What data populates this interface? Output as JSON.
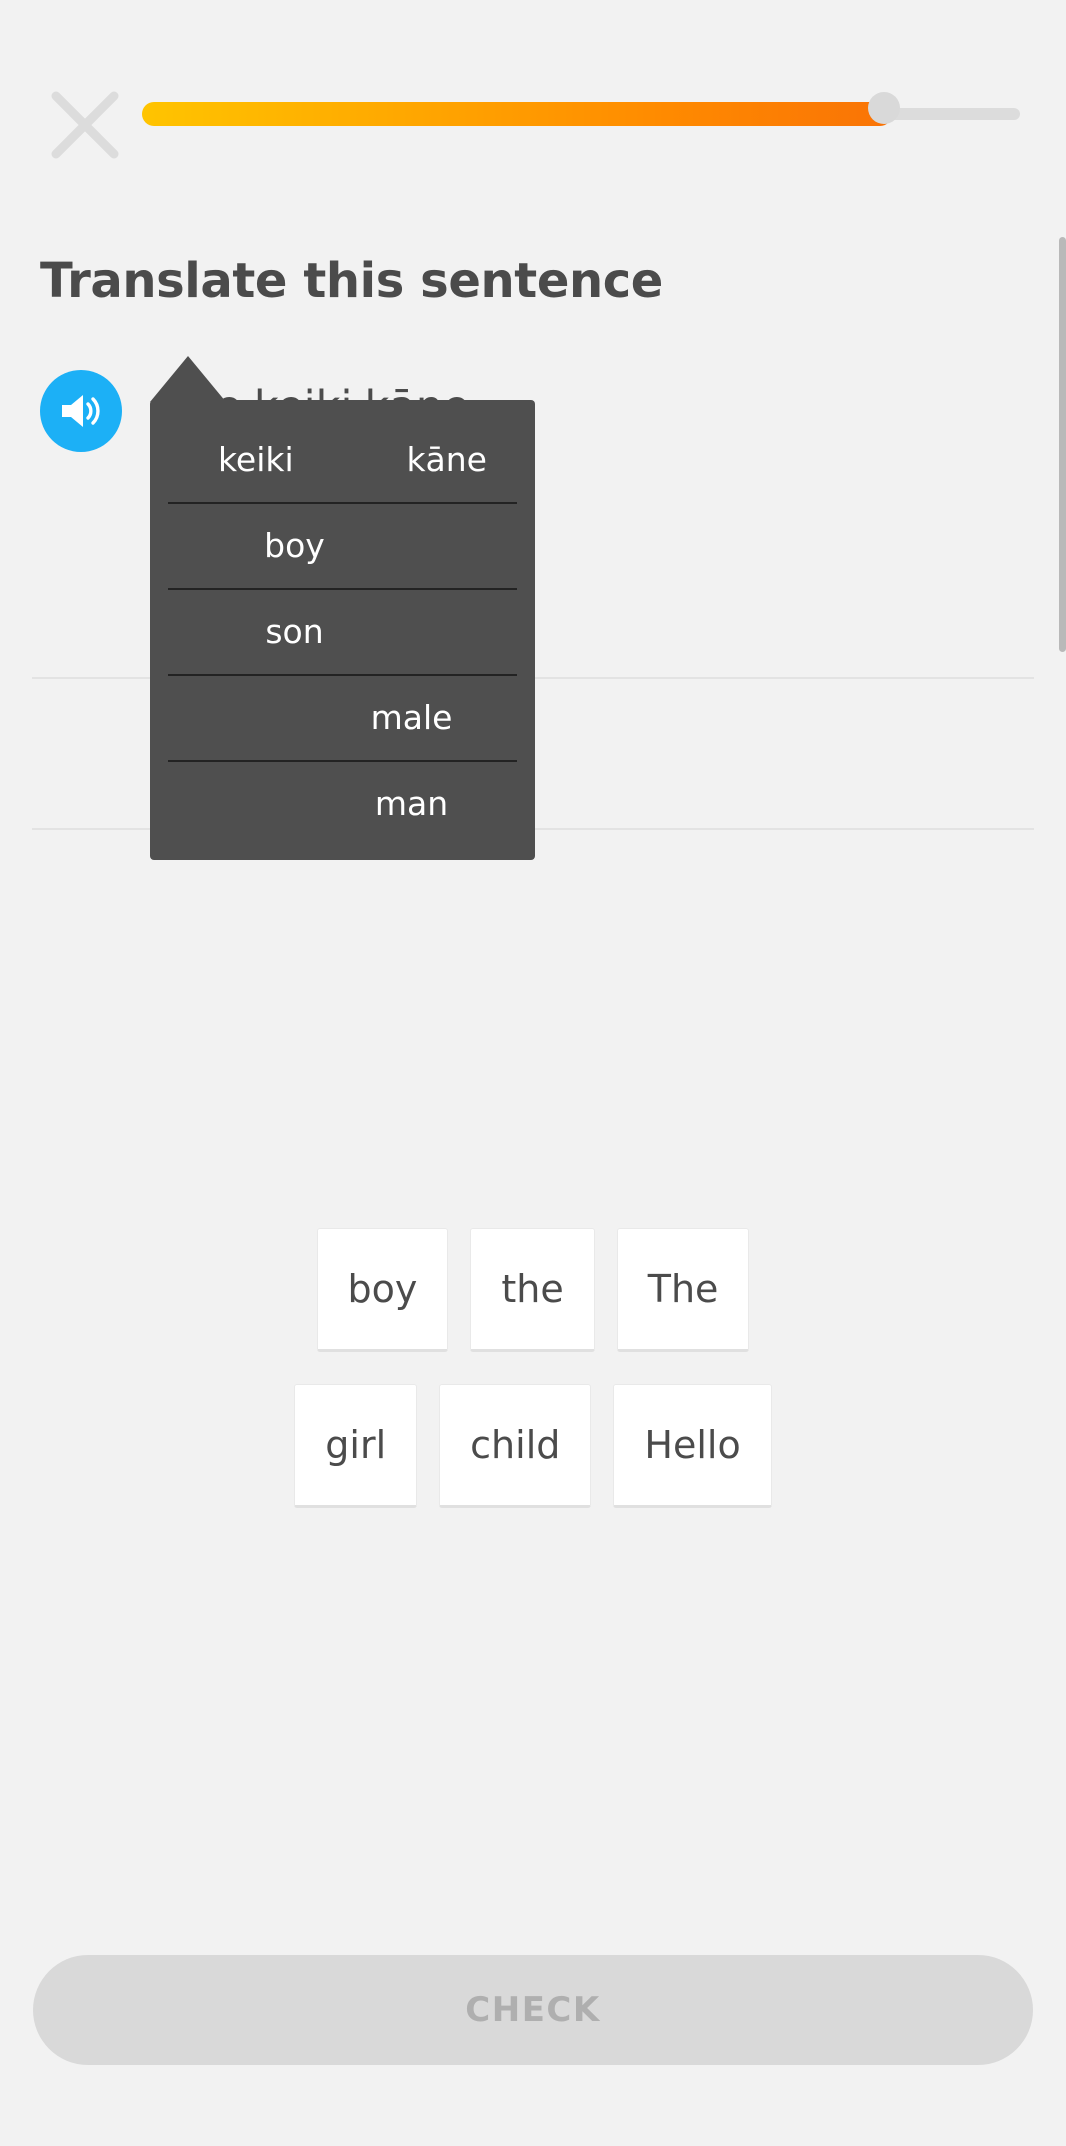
{
  "header": {
    "close_icon": "close-x-icon",
    "progress": {
      "percent": 85,
      "fill_color_start": "#ffc400",
      "fill_color_end": "#f97306",
      "track_color": "#dcdcdc",
      "knob_color": "#d9d9d9"
    }
  },
  "page_title": "Translate this sentence",
  "prompt": {
    "speaker_icon": "speaker-volume-icon",
    "speaker_color": "#1cb0f6",
    "sentence_words": [
      "ke",
      "keiki",
      "kāne"
    ]
  },
  "hint_popup": {
    "headwords": {
      "left": "keiki",
      "right": "kāne"
    },
    "definitions": [
      {
        "text": "boy",
        "column": "left"
      },
      {
        "text": "son",
        "column": "left"
      },
      {
        "text": "male",
        "column": "right"
      },
      {
        "text": "man",
        "column": "right"
      }
    ],
    "background_color": "#4f4f4f",
    "divider_color": "#232323"
  },
  "word_bank": {
    "rows": [
      [
        "boy",
        "the",
        "The"
      ],
      [
        "girl",
        "child",
        "Hello"
      ]
    ]
  },
  "check_button": {
    "label": "CHECK",
    "enabled": false,
    "background_color": "#d9d9d9",
    "text_color": "#afafaf"
  }
}
